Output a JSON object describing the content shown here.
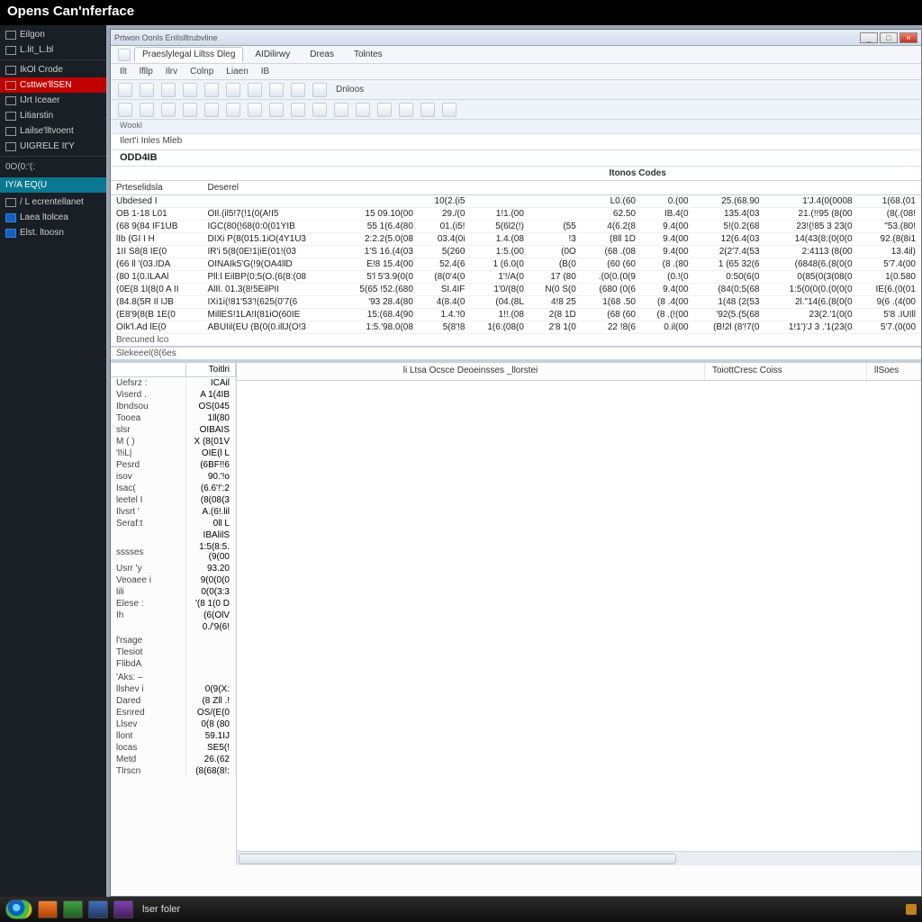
{
  "title": "Opens Can'nferface",
  "sidebar": {
    "group1": [
      {
        "label": "Eilgon"
      },
      {
        "label": "L.lit_L.bl"
      }
    ],
    "group2": [
      {
        "label": "IkOl Crode"
      },
      {
        "label": "Csttwe'llSEN",
        "red": true
      },
      {
        "label": "IJrt Iceaer"
      },
      {
        "label": "Litiarstin"
      },
      {
        "label": "Lailse'lltvoent"
      },
      {
        "label": "UIGRELE It'Y"
      }
    ],
    "sec1_label": "0O(0:'(:",
    "sel_label": "IY/A EQ(U",
    "group3": [
      {
        "label": "/ L  ecrentellanet"
      },
      {
        "label": "Laea ltolcea",
        "blue": true
      },
      {
        "label": "Elst. ltoosn",
        "blue": true
      }
    ]
  },
  "inner": {
    "title": "Prtwon Oonls EnIlslltrubvline",
    "menu_tabs": [
      "Praeslylegal Liltss Dleg",
      "AIDilirwy",
      "Dreas",
      "Tolntes"
    ],
    "menu2": [
      "Ilt",
      "lfllp",
      "Ilrv",
      "Colnp",
      "Liaen",
      "IB"
    ],
    "tool_label": "Dnloos",
    "subbar": "Wookl",
    "pathbar": "Ilert'i  Inles  Mleb",
    "section": "ODD4IB"
  },
  "grid": {
    "top_mid_header": "Itonos Codes",
    "headers": {
      "c0": "Prteselidsla",
      "c1": "Deserel",
      "c2": "",
      "c3": "",
      "c4": "",
      "c5": "",
      "c6": "",
      "c7": "",
      "c8": "",
      "c9": "",
      "c10": ""
    },
    "rows": [
      {
        "c0": "Ubdesed I",
        "c1": "",
        "c2": "",
        "c3": "10(2.(i5",
        "c4": "",
        "c5": "",
        "c6": "L0.(60",
        "c7": "0.(00",
        "c8": "25.(68.90",
        "c9": "1'J.4(0(0008",
        "c10": "1(68.(01"
      },
      {
        "c0": "OB 1-18 L01",
        "c1": "OIl.(il5!7(!1(0(A!I5",
        "c2": "15 09.10(00",
        "c3": "29./(0",
        "c4": "1!1.(00",
        "c5": "",
        "c6": "62.50",
        "c7": "IB.4(0",
        "c8": "135.4(03",
        "c9": "21.(!!95 (8(00",
        "c10": "(8(.(08!"
      },
      {
        "c0": "(68 9(84 IF1UB",
        "c1": "IGC(80(!68(0:0(01YIB",
        "c2": "55 1(6.4(80",
        "c3": "01.(i5!",
        "c4": "5(6l2(!)",
        "c5": "(55",
        "c6": "4(6.2(8",
        "c7": "9.4(00",
        "c8": "5!(0.2(68",
        "c9": "23!(!85 3 23(0",
        "c10": "\"53.(80!"
      },
      {
        "c0": "lIb (GI  I H",
        "c1": "DIXi P(8(015.1iO(4Y1U3",
        "c2": "2:2.2(5.0(08",
        "c3": "03.4(0i",
        "c4": "1.4.(08",
        "c5": "!3",
        "c6": "(8ll 1D",
        "c7": "9.4(00",
        "c8": "12(6.4(03",
        "c9": "14(43(8:(0(0(0",
        "c10": "92.(8(8i1"
      },
      {
        "c0": "1II S8(8  IE(0",
        "c1": "IR'i  5(8(0E!1|iE(01!(03",
        "c2": "1'S 16.(4(03",
        "c3": "5(260",
        "c4": "1:5.(00",
        "c5": "(0O",
        "c6": "(68 .(08",
        "c7": "9.4(00",
        "c8": "2(2'7.4(53",
        "c9": "2:4113 (8(00",
        "c10": "13.4il) "
      },
      {
        "c0": "(66 ll '(03.IDA",
        "c1": "OINAIk5'G(!9(OA4llD",
        "c2": "E!8 15.4(00",
        "c3": "52.4(6",
        "c4": "1 (6.0(0",
        "c5": "(B(0",
        "c6": "(60 (60",
        "c7": "(8 .(80",
        "c8": "1 (65 32(6",
        "c9": "(6848(6.(8(0(0",
        "c10": "5'7.4(00"
      },
      {
        "c0": "(80 1(0.ILAAl",
        "c1": "Pll:l EilBP(0;5(O.(6(8:(08",
        "c2": "5'l 5'3.9(0(0",
        "c3": "(8(0'4(0",
        "c4": "1'!/A(0",
        "c5": "17  (80",
        "c6": ".(0(0.(0(9",
        "c7": "(0.!(0",
        "c8": "0:50(6(0",
        "c9": "0(85(0(3(08(0",
        "c10": "1(0.580"
      },
      {
        "c0": "(0E(8 1l(8(0  A II",
        "c1": "AlIl. 01.3(8!5EilPII",
        "c2": "5(65 !52.(680",
        "c3": "SI.4IF",
        "c4": "1'0/(8(0",
        "c5": "N(0  S(0",
        "c6": "(680 (0(6",
        "c7": "9.4(00",
        "c8": "(84(0;5(68",
        "c9": "1:5(0(0(0.(0(0(0",
        "c10": "IE(6.(0(01"
      },
      {
        "c0": "(84.8(5R  Il IJB",
        "c1": "IXi1i(!81'53'!(625(0'7(6",
        "c2": "'93 28.4(80",
        "c3": "4(8.4(0",
        "c4": "(04.(8L",
        "c5": "4!8  25",
        "c6": "1(68 .50",
        "c7": "(8 .4(00",
        "c8": "1(48 (2(53",
        "c9": "2l.\"14(6.(8(0(0",
        "c10": "9(6 .(4(00"
      },
      {
        "c0": "(E8'9(8(B 1E(0",
        "c1": "MillES!1LA!I(81iO(60IE",
        "c2": "15:(68.4(90",
        "c3": "1.4.'!0",
        "c4": "1!!.(08",
        "c5": "2(8  1D",
        "c6": "(68 (60",
        "c7": "(8 .(!(00",
        "c8": "'92(5.(5(68",
        "c9": "23(2.'1(0(0",
        "c10": "5'8 .IUIll"
      },
      {
        "c0": "OIk'l.Ad lE(0",
        "c1": "ABUIil(EU (B(0(0.illJ(O!3",
        "c2": "1:5.'98.0(08",
        "c3": "5(8'!8",
        "c4": "1(6:(08(0",
        "c5": "2'8  1(0",
        "c6": "22 !8(6",
        "c7": "0.il(00",
        "c8": "(B!2l (8'!7(0",
        "c9": "1!1')'J 3 .'1(23(0",
        "c10": "5'7.(0(00"
      }
    ],
    "footer": "Brecuned lco",
    "footer2": "Slekeeel(8(6es"
  },
  "lower": {
    "left_headers": {
      "h1": "Toitlri",
      "h2": ""
    },
    "left_rows": [
      [
        "Uefsrz :",
        "ICAil"
      ],
      [
        "Viserd .",
        "A 1(4IB"
      ],
      [
        "Ibndsou",
        "OS(045"
      ],
      [
        "Tooea",
        "1ll(80"
      ],
      [
        "slsr",
        "OIBAIS"
      ],
      [
        "M ( )",
        "X (8(01V"
      ],
      [
        "'l!iL|",
        "OIE(l L"
      ],
      [
        "Pesrd",
        "(6BF!!6"
      ],
      [
        "isov",
        "90.'!o"
      ],
      [
        "Isac(",
        "(6.6'!':2"
      ],
      [
        "leetel I",
        "(8(08(3"
      ],
      [
        "Ilvsrt '",
        "A.(6!.lil"
      ],
      [
        "Seraf:t",
        "0ll L"
      ],
      [
        "",
        "IBAlilS"
      ],
      [
        "sssses",
        "1:5(8:5.(9(00"
      ],
      [
        "Usrr 'y",
        "93.20"
      ],
      [
        "Veoaee i",
        "9(0(0(0"
      ],
      [
        "lili",
        "0(0(3:3"
      ],
      [
        "Elese :",
        "'(8 1(0 D"
      ],
      [
        "Ih",
        "(6(OlV"
      ],
      [
        "",
        "0./'9(6!"
      ],
      [
        "",
        ""
      ],
      [
        "l'rsage",
        ""
      ],
      [
        "Tlesiot",
        ""
      ],
      [
        "FlibdA",
        ""
      ],
      [
        "",
        ""
      ],
      [
        "'Aks: –",
        ""
      ],
      [
        "llshev i",
        "0(9(X:"
      ],
      [
        "Dared",
        "(8 Zll .!"
      ],
      [
        "Esnred",
        "OS/(E(0"
      ],
      [
        "Llsev",
        "0(8 (80"
      ],
      [
        "llont",
        "59.1IJ"
      ],
      [
        "locas",
        "SE5(!"
      ],
      [
        "Metd",
        "26.(62"
      ],
      [
        "Tlrscn",
        "(8(68(8!:"
      ]
    ],
    "right_headers": [
      "li Ltsa Ocsce Deoeinsses _llorstei",
      "ToiottCresc Coiss",
      "llSoes"
    ]
  },
  "taskbar": {
    "label": "lser foler"
  }
}
